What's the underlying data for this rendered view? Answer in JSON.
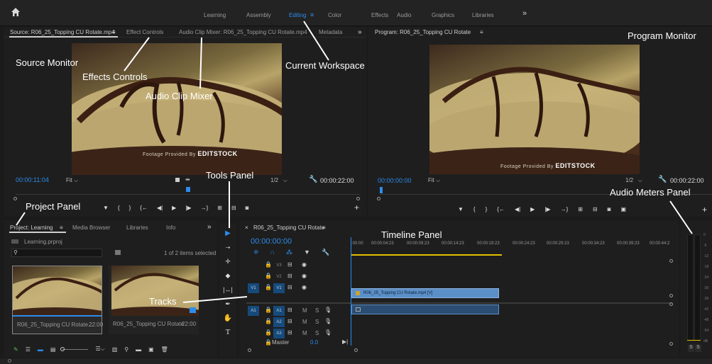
{
  "workspaces": {
    "home": "⌂",
    "items": [
      "Learning",
      "Assembly",
      "Editing",
      "Color",
      "Effects",
      "Audio",
      "Graphics",
      "Libraries"
    ],
    "more": "»",
    "menu": "≡"
  },
  "source": {
    "tab": "Source: R06_25_Topping CU Rotate.mp4",
    "menu": "≡",
    "tabs": [
      "Effect Controls",
      "Audio Clip Mixer: R06_25_Topping CU Rotate.mp4",
      "Metadata"
    ],
    "more": "»",
    "timecode": "00:00:11:04",
    "fit": "Fit",
    "ratio": "1/2",
    "duration": "00:00:22:00"
  },
  "program": {
    "tab": "Program: R06_25_Topping CU Rotate",
    "menu": "≡",
    "timecode": "00:00:00:00",
    "fit": "Fit",
    "ratio": "1/2",
    "duration": "00:00:22:00"
  },
  "watermark": {
    "prefix": "Footage Provided By",
    "brand": "EDITSTOCK"
  },
  "project": {
    "tabs": [
      "Project: Learning",
      "Media Browser",
      "Libraries",
      "Info"
    ],
    "more": "»",
    "menu": "≡",
    "file": "Learning.prproj",
    "count": "1 of 2 items selected",
    "search_placeholder": "",
    "items": [
      {
        "name": "R06_25_Topping CU Rotate...",
        "duration": "22:00"
      },
      {
        "name": "R06_25_Topping CU Rotate",
        "duration": "22:00"
      }
    ]
  },
  "timeline": {
    "tab": "R06_25_Topping CU Rotate",
    "menu": "≡",
    "close": "×",
    "timecode": "00:00:00:00",
    "ruler": [
      ":00:00",
      "00:00:04:23",
      "00:00:09:23",
      "00:00:14:23",
      "00:00:19:23",
      "00:00:24:23",
      "00:00:29:23",
      "00:00:34:23",
      "00:00:39:23",
      "00:00:44:2"
    ],
    "video_tracks": [
      "V3",
      "V2",
      "V1"
    ],
    "audio_tracks": [
      "A1",
      "A2",
      "A3"
    ],
    "source_v": "V1",
    "source_a": "A1",
    "master": "Master",
    "master_val": "0.0",
    "clip_label": "R06_25_Topping CU Rotate.mp4 [V]",
    "m": "M",
    "s": "S"
  },
  "meters": {
    "scale": [
      "0",
      "-6",
      "-12",
      "-18",
      "-24",
      "-30",
      "-36",
      "-42",
      "-48",
      "-54",
      "dB"
    ],
    "solo": [
      "S",
      "S"
    ]
  },
  "annotations": {
    "program_monitor": "Program Monitor",
    "source_monitor": "Source Monitor",
    "effects_controls": "Effects Controls",
    "audio_clip_mixer": "Audio Clip Mixer",
    "current_workspace": "Current Workspace",
    "tools_panel": "Tools Panel",
    "audio_meters_panel": "Audio Meters Panel",
    "project_panel": "Project Panel",
    "timeline_panel": "Timeline Panel",
    "tracks": "Tracks"
  },
  "colors": {
    "accent": "#2d8ceb",
    "track_blue": "#164a7a",
    "clip_blue": "#5b8fc7",
    "playhead": "#2d8ceb",
    "work_area": "#e3c000"
  }
}
